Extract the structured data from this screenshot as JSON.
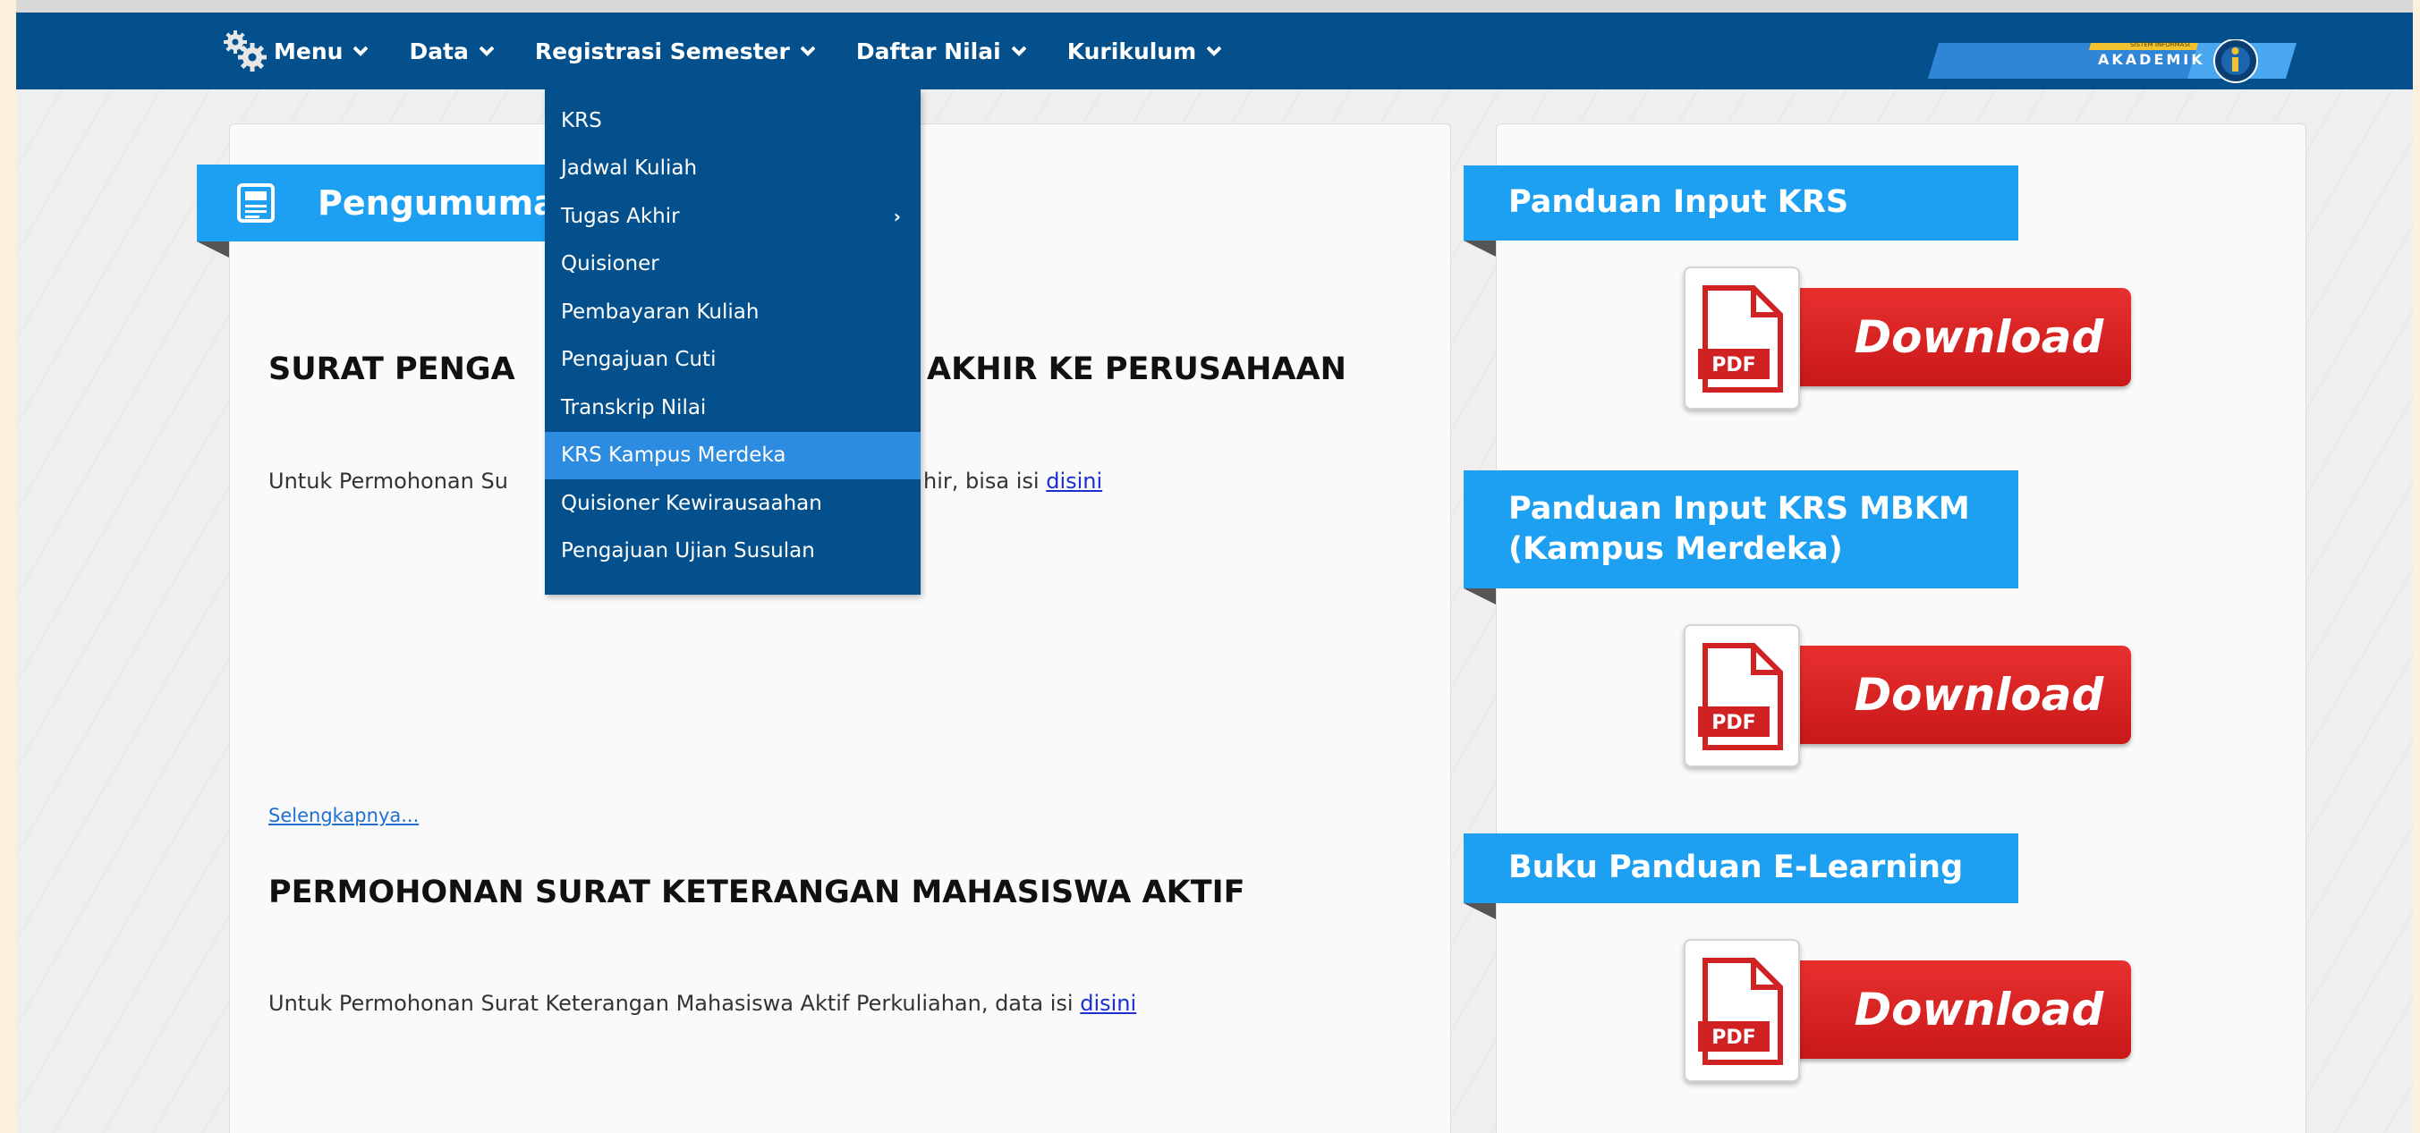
{
  "nav": {
    "items": [
      {
        "label": "Menu"
      },
      {
        "label": "Data"
      },
      {
        "label": "Registrasi Semester"
      },
      {
        "label": "Daftar Nilai"
      },
      {
        "label": "Kurikulum"
      }
    ],
    "badge_label": "AKADEMIK",
    "badge_small": "SISTEM INFORMASI"
  },
  "dropdown": {
    "items": [
      {
        "label": "KRS"
      },
      {
        "label": "Jadwal Kuliah"
      },
      {
        "label": "Tugas Akhir"
      },
      {
        "label": "Quisioner"
      },
      {
        "label": "Pembayaran Kuliah"
      },
      {
        "label": "Pengajuan Cuti"
      },
      {
        "label": "Transkrip Nilai"
      },
      {
        "label": "KRS Kampus Merdeka"
      },
      {
        "label": "Quisioner Kewirausaahan"
      },
      {
        "label": "Pengajuan Ujian Susulan"
      }
    ]
  },
  "announcements": {
    "title": "Pengumuma",
    "articles": [
      {
        "title_visible_left": "SURAT PENGA",
        "title_visible_right": "AKHIR KE PERUSAHAAN",
        "text_left": "Untuk Permohonan Su",
        "text_right": "hir, bisa isi ",
        "link": "disini"
      },
      {
        "title": "PERMOHONAN SURAT KETERANGAN MAHASISWA AKTIF",
        "text": "Untuk Permohonan Surat Keterangan Mahasiswa Aktif Perkuliahan, data isi ",
        "link": "disini"
      }
    ],
    "more_link": "Selengkapnya..."
  },
  "sidebar": {
    "sections": [
      {
        "title": "Panduan Input KRS",
        "button": "Download",
        "pdf_label": "PDF"
      },
      {
        "title_line1": "Panduan Input KRS MBKM",
        "title_line2": "(Kampus Merdeka)",
        "button": "Download",
        "pdf_label": "PDF"
      },
      {
        "title": "Buku Panduan E-Learning",
        "button": "Download",
        "pdf_label": "PDF"
      }
    ]
  },
  "colors": {
    "navbar": "#03508c",
    "ribbon": "#1da0f2",
    "download": "#d62222",
    "active_item": "#2d8ce0"
  }
}
